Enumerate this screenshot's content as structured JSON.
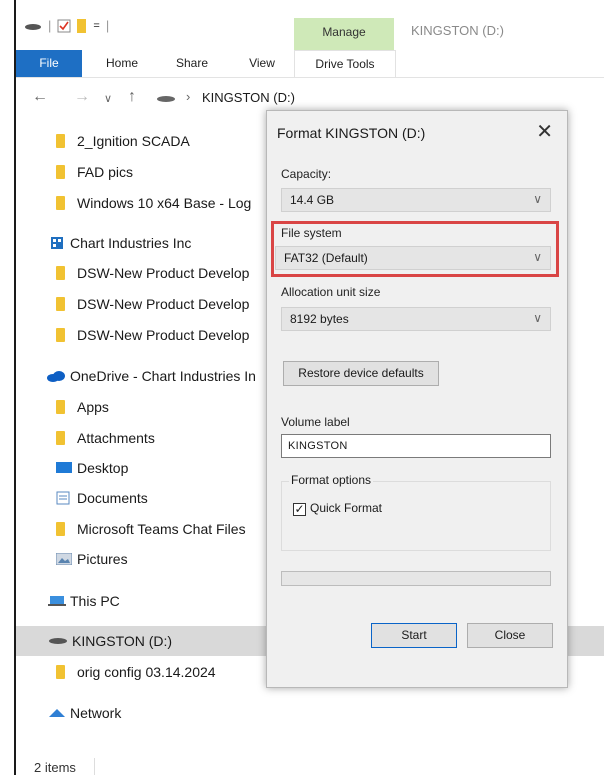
{
  "window": {
    "title": "KINGSTON (D:)",
    "contextual_tab_group": "Manage"
  },
  "ribbon": {
    "tabs": [
      "File",
      "Home",
      "Share",
      "View",
      "Drive Tools"
    ]
  },
  "address": {
    "path": "KINGSTON (D:)"
  },
  "nav_items": [
    {
      "label": "2_Ignition SCADA",
      "icon": "folder-icon"
    },
    {
      "label": "FAD pics",
      "icon": "folder-icon"
    },
    {
      "label": "Windows 10 x64 Base - Log",
      "icon": "folder-icon"
    },
    {
      "label": "Chart Industries Inc",
      "icon": "building-icon"
    },
    {
      "label": "DSW-New Product Develop",
      "icon": "folder-icon"
    },
    {
      "label": "DSW-New Product Develop",
      "icon": "folder-icon"
    },
    {
      "label": "DSW-New Product Develop",
      "icon": "folder-icon"
    },
    {
      "label": "OneDrive - Chart Industries In",
      "icon": "cloud-icon"
    },
    {
      "label": "Apps",
      "icon": "folder-icon"
    },
    {
      "label": "Attachments",
      "icon": "folder-icon"
    },
    {
      "label": "Desktop",
      "icon": "desktop-icon"
    },
    {
      "label": "Documents",
      "icon": "documents-icon"
    },
    {
      "label": "Microsoft Teams Chat Files",
      "icon": "folder-icon"
    },
    {
      "label": "Pictures",
      "icon": "pictures-icon"
    },
    {
      "label": "This PC",
      "icon": "computer-icon"
    },
    {
      "label": "KINGSTON (D:)",
      "icon": "drive-icon"
    },
    {
      "label": "orig config 03.14.2024",
      "icon": "folder-icon"
    },
    {
      "label": "Network",
      "icon": "network-icon"
    }
  ],
  "status": {
    "items_count": "2 items"
  },
  "dialog": {
    "title": "Format KINGSTON (D:)",
    "capacity_label": "Capacity:",
    "capacity_value": "14.4 GB",
    "filesystem_label": "File system",
    "filesystem_value": "FAT32 (Default)",
    "allocation_label": "Allocation unit size",
    "allocation_value": "8192 bytes",
    "restore_button": "Restore device defaults",
    "volume_label_label": "Volume label",
    "volume_label_value": "KINGSTON",
    "format_options_label": "Format options",
    "quick_format_label": "Quick Format",
    "quick_format_checked": true,
    "start_button": "Start",
    "close_button": "Close"
  },
  "colors": {
    "file_tab": "#1e6fc4",
    "manage_tab": "#cfe9b8",
    "highlight_box": "#d94545",
    "folder": "#f1c232"
  }
}
